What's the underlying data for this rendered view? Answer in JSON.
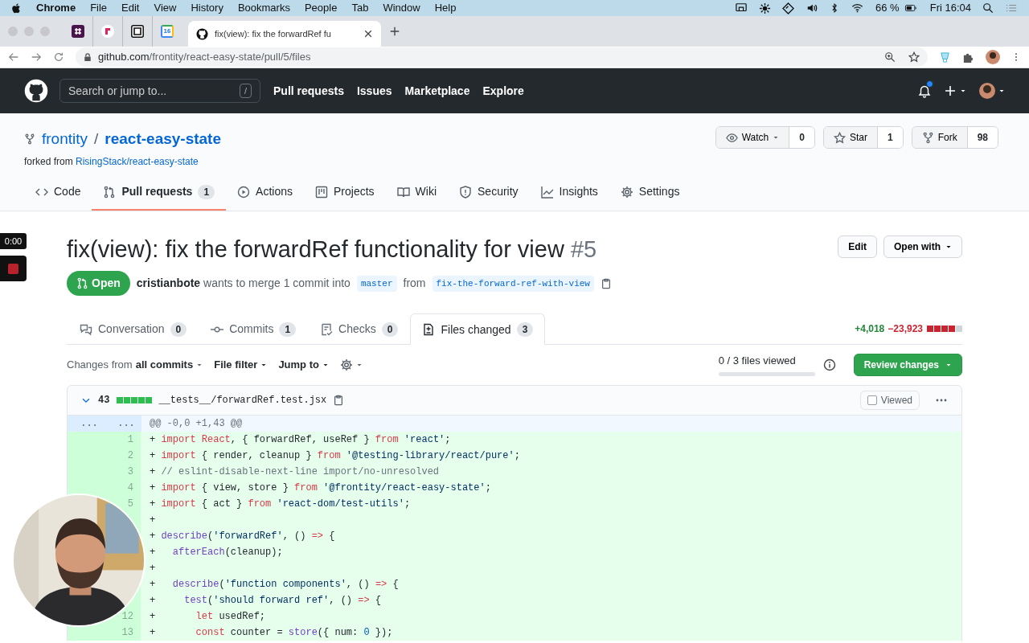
{
  "menubar": {
    "app_menus": [
      "Chrome",
      "File",
      "Edit",
      "View",
      "History",
      "Bookmarks",
      "People",
      "Tab",
      "Window",
      "Help"
    ],
    "battery": "66 %",
    "clock": "Fri 16:04"
  },
  "browser": {
    "pinned_tabs": [
      {
        "kind": "grid"
      },
      {
        "kind": "f"
      },
      {
        "kind": "notion"
      },
      {
        "kind": "calendar",
        "label": "16"
      }
    ],
    "active_tab": {
      "title": "fix(view): fix the forwardRef fu"
    },
    "url": {
      "host": "github.com",
      "path": "/frontity/react-easy-state/pull/5/files"
    }
  },
  "header": {
    "search": {
      "placeholder": "Search or jump to...",
      "key": "/"
    },
    "nav": [
      "Pull requests",
      "Issues",
      "Marketplace",
      "Explore"
    ]
  },
  "repo": {
    "owner": "frontity",
    "separator": "/",
    "name": "react-easy-state",
    "forked_label": "forked from",
    "forked_from": "RisingStack/react-easy-state",
    "actions": [
      {
        "kind": "watch",
        "label": "Watch",
        "count": "0"
      },
      {
        "kind": "star",
        "label": "Star",
        "count": "1"
      },
      {
        "kind": "fork",
        "label": "Fork",
        "count": "98"
      }
    ]
  },
  "repo_tabs": [
    {
      "kind": "code",
      "label": "Code",
      "selected": false
    },
    {
      "kind": "pr",
      "label": "Pull requests",
      "count": "1",
      "selected": true
    },
    {
      "kind": "actions",
      "label": "Actions",
      "selected": false
    },
    {
      "kind": "projects",
      "label": "Projects",
      "selected": false
    },
    {
      "kind": "wiki",
      "label": "Wiki",
      "selected": false
    },
    {
      "kind": "security",
      "label": "Security",
      "selected": false
    },
    {
      "kind": "insights",
      "label": "Insights",
      "selected": false
    },
    {
      "kind": "settings",
      "label": "Settings",
      "selected": false
    }
  ],
  "pr": {
    "title": "fix(view): fix the forwardRef functionality for view",
    "number": "#5",
    "state": "Open",
    "author": "cristianbote",
    "merge_text": "wants to merge 1 commit into",
    "base": "master",
    "from_text": "from",
    "head": "fix-the-forward-ref-with-view",
    "buttons": [
      {
        "label": "Edit",
        "caret": false
      },
      {
        "label": "Open with",
        "caret": true
      }
    ]
  },
  "pr_tabs": [
    {
      "kind": "conversation",
      "label": "Conversation",
      "count": "0",
      "selected": false
    },
    {
      "kind": "commits",
      "label": "Commits",
      "count": "1",
      "selected": false
    },
    {
      "kind": "checks",
      "label": "Checks",
      "count": "0",
      "selected": false
    },
    {
      "kind": "files",
      "label": "Files changed",
      "count": "3",
      "selected": true
    }
  ],
  "diffstat": {
    "additions": "+4,018",
    "deletions": "−23,923",
    "blocks": [
      {
        "kind": "deleted"
      },
      {
        "kind": "deleted"
      },
      {
        "kind": "deleted"
      },
      {
        "kind": "deleted"
      },
      {
        "kind": "neutral"
      }
    ]
  },
  "toolbar": {
    "changes_label": "Changes from",
    "changes_value": "all commits",
    "filters": [
      "File filter",
      "Jump to"
    ],
    "files_viewed": {
      "text": "0 / 3 files viewed",
      "level": 0
    },
    "review_button": "Review changes"
  },
  "file": {
    "expanded": true,
    "count": "43",
    "blocks": [
      {
        "kind": "added"
      },
      {
        "kind": "added"
      },
      {
        "kind": "added"
      },
      {
        "kind": "added"
      },
      {
        "kind": "added"
      }
    ],
    "path": "__tests__/forwardRef.test.jsx",
    "viewed": false,
    "viewed_label": "Viewed",
    "hunk": {
      "old_marker": "...",
      "new_marker": "...",
      "header": "@@ -0,0 +1,43 @@"
    },
    "lines": [
      {
        "new": "1",
        "sign": "+",
        "tokens": [
          {
            "kind": "kw",
            "t": "import React"
          },
          {
            "kind": "plain",
            "t": ", { forwardRef, useRef } "
          },
          {
            "kind": "kw",
            "t": "from"
          },
          {
            "kind": "str",
            "t": " 'react'"
          },
          {
            "kind": "plain",
            "t": ";"
          }
        ]
      },
      {
        "new": "2",
        "sign": "+",
        "tokens": [
          {
            "kind": "kw",
            "t": "import"
          },
          {
            "kind": "plain",
            "t": " { render, cleanup } "
          },
          {
            "kind": "kw",
            "t": "from"
          },
          {
            "kind": "str",
            "t": " '@testing-library/react/pure'"
          },
          {
            "kind": "plain",
            "t": ";"
          }
        ]
      },
      {
        "new": "3",
        "sign": "+",
        "tokens": [
          {
            "kind": "com",
            "t": "// eslint-disable-next-line import/no-unresolved"
          }
        ]
      },
      {
        "new": "4",
        "sign": "+",
        "tokens": [
          {
            "kind": "kw",
            "t": "import"
          },
          {
            "kind": "plain",
            "t": " { view, store } "
          },
          {
            "kind": "kw",
            "t": "from"
          },
          {
            "kind": "str",
            "t": " '@frontity/react-easy-state'"
          },
          {
            "kind": "plain",
            "t": ";"
          }
        ]
      },
      {
        "new": "5",
        "sign": "+",
        "tokens": [
          {
            "kind": "kw",
            "t": "import"
          },
          {
            "kind": "plain",
            "t": " { act } "
          },
          {
            "kind": "kw",
            "t": "from"
          },
          {
            "kind": "str",
            "t": " 'react-dom/test-utils'"
          },
          {
            "kind": "plain",
            "t": ";"
          }
        ]
      },
      {
        "sign": "+"
      },
      {
        "sign": "+",
        "tokens": [
          {
            "kind": "fn",
            "t": "describe"
          },
          {
            "kind": "plain",
            "t": "("
          },
          {
            "kind": "str",
            "t": "'forwardRef'"
          },
          {
            "kind": "plain",
            "t": ", () "
          },
          {
            "kind": "kw",
            "t": "=>"
          },
          {
            "kind": "plain",
            "t": " {"
          }
        ]
      },
      {
        "sign": "+",
        "tokens": [
          {
            "kind": "fn",
            "t": "  afterEach"
          },
          {
            "kind": "plain",
            "t": "(cleanup);"
          }
        ]
      },
      {
        "sign": "+"
      },
      {
        "sign": "+",
        "tokens": [
          {
            "kind": "fn",
            "t": "  describe"
          },
          {
            "kind": "plain",
            "t": "("
          },
          {
            "kind": "str",
            "t": "'function components'"
          },
          {
            "kind": "plain",
            "t": ", () "
          },
          {
            "kind": "kw",
            "t": "=>"
          },
          {
            "kind": "plain",
            "t": " {"
          }
        ]
      },
      {
        "sign": "+",
        "tokens": [
          {
            "kind": "fn",
            "t": "    test"
          },
          {
            "kind": "plain",
            "t": "("
          },
          {
            "kind": "str",
            "t": "'should forward ref'"
          },
          {
            "kind": "plain",
            "t": ", () "
          },
          {
            "kind": "kw",
            "t": "=>"
          },
          {
            "kind": "plain",
            "t": " {"
          }
        ]
      },
      {
        "new": "12",
        "sign": "+",
        "tokens": [
          {
            "kind": "kw",
            "t": "      let"
          },
          {
            "kind": "plain",
            "t": " usedRef;"
          }
        ]
      },
      {
        "new": "13",
        "sign": "+",
        "tokens": [
          {
            "kind": "kw",
            "t": "      const"
          },
          {
            "kind": "plain",
            "t": " counter = "
          },
          {
            "kind": "fn",
            "t": "store"
          },
          {
            "kind": "plain",
            "t": "({ num: "
          },
          {
            "kind": "num",
            "t": "0"
          },
          {
            "kind": "plain",
            "t": " });"
          }
        ]
      }
    ]
  },
  "overlay": {
    "recorder": {
      "time": "0:00"
    }
  }
}
